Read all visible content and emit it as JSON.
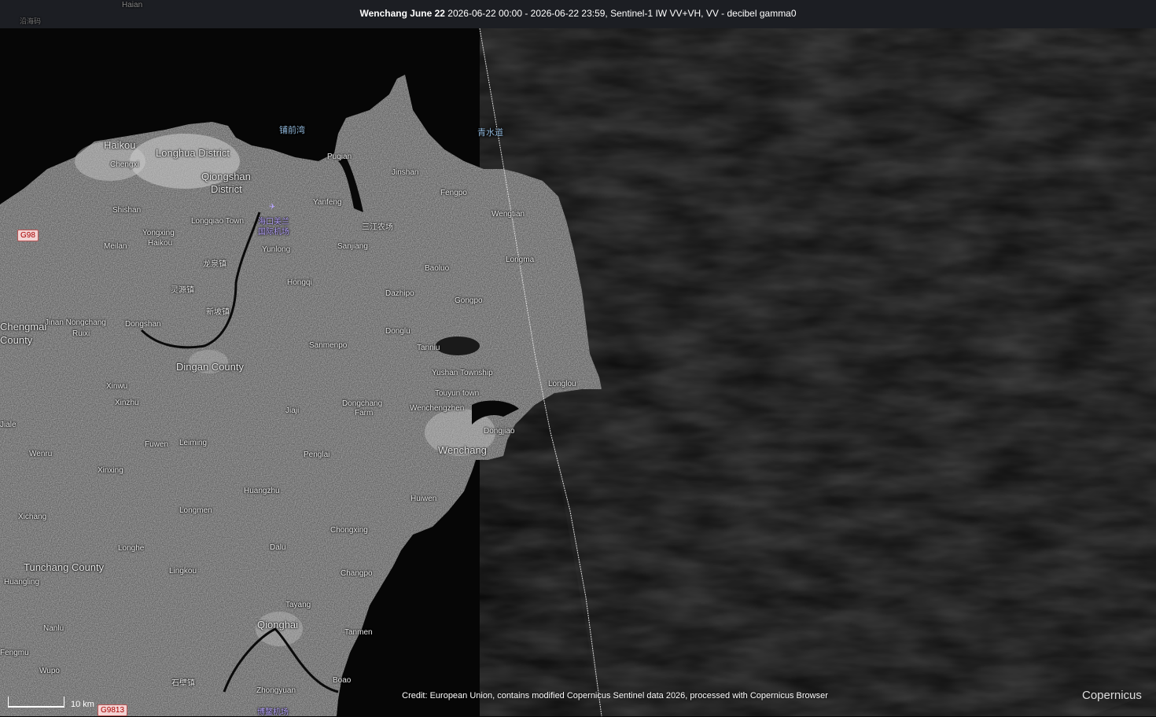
{
  "header": {
    "title_bold": "Wenchang June 22",
    "title_rest": " 2026-06-22 00:00 - 2026-06-22 23:59, Sentinel-1 IW VV+VH, VV - decibel gamma0"
  },
  "top_strip_labels": [
    "Haian",
    "沿海码"
  ],
  "place_labels": [
    "Haikou",
    "Longhua District",
    "Qiongshan",
    "District",
    "Chengxi",
    "Shishan",
    "Longqiao Town",
    "Yongxing",
    "Haikou",
    "Meilan",
    "龙泉镇",
    "Yunlong",
    "Hongqi",
    "Yanfeng",
    "Puqian",
    "Jinshan",
    "Fengpo",
    "Wengtian",
    "三江农场",
    "Sanjiang",
    "Longma",
    "Baoluo",
    "Dazhipo",
    "Gongpo",
    "Dongshan",
    "Jinan Nongchang",
    "Ruixi",
    "Dingan County",
    "新坡镇",
    "灵源镇",
    "Sanmenpo",
    "Donglu",
    "Tanniu",
    "Yushan Township",
    "Touyun town",
    "Longlou",
    "Wenchengzhen",
    "Dongjiao",
    "Wenchang",
    "Dongchang",
    "Farm",
    "Jiaji",
    "Xinwu",
    "Xinzhu",
    "Jiale",
    "Wenru",
    "Fuwen",
    "Leiming",
    "Penglai",
    "Xinxing",
    "Xichang",
    "Longmen",
    "Huangzhu",
    "Huiwen",
    "Chongxing",
    "Dalu",
    "Longhe",
    "Lingkou",
    "Tunchang County",
    "Huangling",
    "Changpo",
    "Tayang",
    "Qionghai",
    "Tanmen",
    "Nanlu",
    "Fengmu",
    "Wupo",
    "Boao",
    "Zhongyuan",
    "石壁镇",
    "Chengmai",
    "County"
  ],
  "water_labels": [
    "铺前湾",
    "青水道"
  ],
  "poi_labels": [
    "海口美兰",
    "国际机场",
    "博鳌机场"
  ],
  "road_shields": [
    "G98",
    "G9813"
  ],
  "scale_bar": {
    "label": "10 km"
  },
  "credit": "Credit: European Union, contains modified Copernicus Sentinel data 2026, processed with Copernicus Browser",
  "logo": "Copernicus"
}
